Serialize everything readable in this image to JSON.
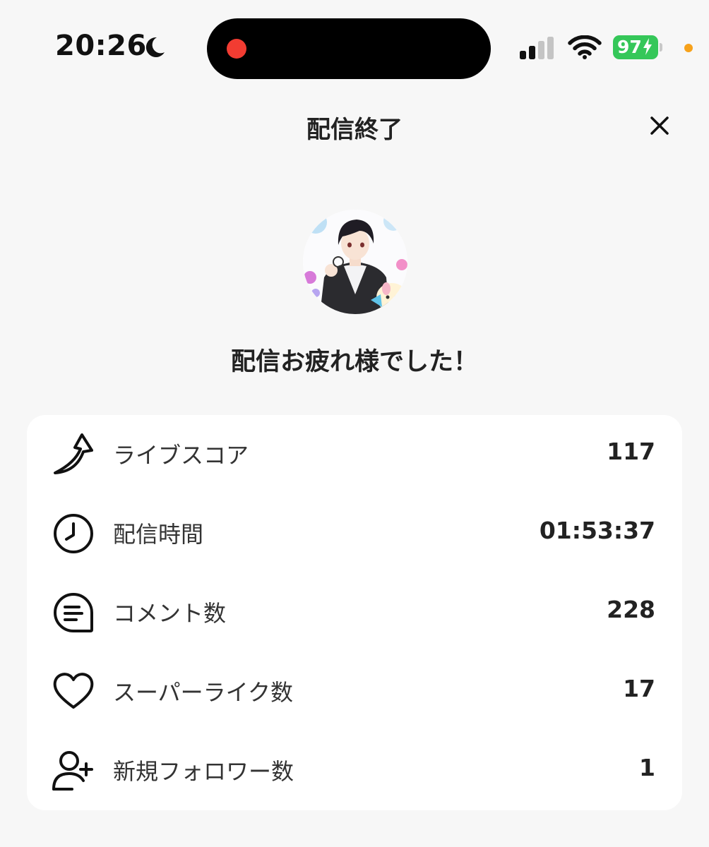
{
  "status_bar": {
    "time": "20:26",
    "battery_level": "97",
    "icons": [
      "moon-icon",
      "signal-icon",
      "wifi-icon",
      "battery-icon"
    ]
  },
  "header": {
    "title": "配信終了",
    "close_icon": "close-icon"
  },
  "message": "配信お疲れ様でした！",
  "stats": [
    {
      "icon": "live-score-arrow-icon",
      "label": "ライブスコア",
      "value": "117"
    },
    {
      "icon": "clock-icon",
      "label": "配信時間",
      "value": "01:53:37"
    },
    {
      "icon": "comment-icon",
      "label": "コメント数",
      "value": "228"
    },
    {
      "icon": "heart-icon",
      "label": "スーパーライク数",
      "value": "17"
    },
    {
      "icon": "add-user-icon",
      "label": "新規フォロワー数",
      "value": "1"
    }
  ],
  "colors": {
    "background": "#f7f7f7",
    "card": "#ffffff",
    "battery": "#35c759",
    "record_dot": "#f23c32",
    "privacy_dot": "#f7a21b"
  }
}
